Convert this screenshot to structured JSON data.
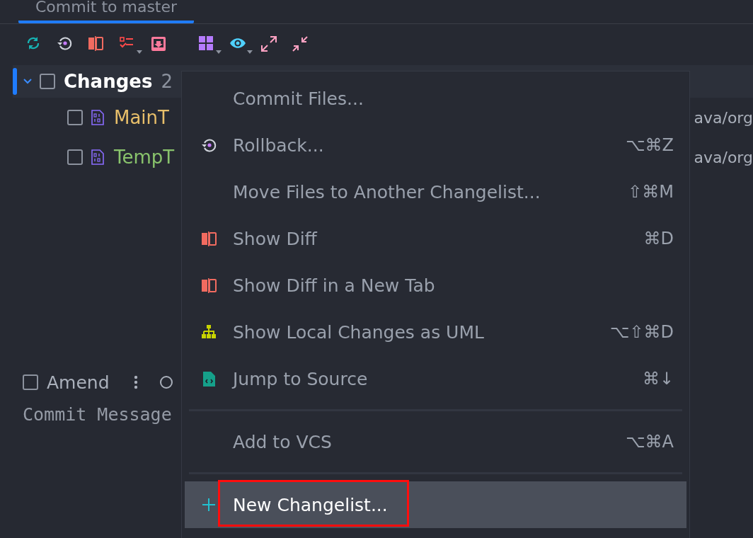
{
  "tab": {
    "label": "Commit to master",
    "selected": true
  },
  "toolbar": {
    "buttons": [
      {
        "kind": "refresh",
        "dropdown": false
      },
      {
        "kind": "rollback",
        "dropdown": false
      },
      {
        "kind": "diff",
        "dropdown": false
      },
      {
        "kind": "checklist",
        "dropdown": true
      },
      {
        "kind": "shelve",
        "dropdown": false
      },
      {
        "kind": "group",
        "dropdown": true
      },
      {
        "kind": "view",
        "dropdown": true
      },
      {
        "kind": "expand",
        "dropdown": false
      },
      {
        "kind": "collapse",
        "dropdown": false
      }
    ]
  },
  "tree": {
    "label": "Changes",
    "count": "2",
    "expanded": true,
    "checked": false,
    "selected": true,
    "children": [
      {
        "name": "MainT",
        "path": "ava/org",
        "color": "#e8bf6a",
        "checked": false
      },
      {
        "name": "TempT",
        "path": "ava/org",
        "color": "#89c36c",
        "checked": false
      }
    ]
  },
  "amend": {
    "label": "Amend",
    "checked": false
  },
  "commit_message": {
    "placeholder": "Commit Message"
  },
  "context_menu": {
    "items": [
      {
        "kind": "action",
        "label": "Commit Files...",
        "selected": false
      },
      {
        "kind": "action",
        "label": "Rollback...",
        "shortcut": "⌥⌘Z",
        "selected": false
      },
      {
        "kind": "action",
        "label": "Move Files to Another Changelist...",
        "shortcut": "⇧⌘M",
        "selected": false
      },
      {
        "kind": "action",
        "label": "Show Diff",
        "shortcut": "⌘D",
        "selected": false
      },
      {
        "kind": "action",
        "label": "Show Diff in a New Tab",
        "selected": false
      },
      {
        "kind": "action",
        "label": "Show Local Changes as UML",
        "shortcut": "⌥⇧⌘D",
        "selected": false
      },
      {
        "kind": "action",
        "label": "Jump to Source",
        "shortcut": "⌘↓",
        "selected": false
      },
      {
        "kind": "separator"
      },
      {
        "kind": "action",
        "label": "Add to VCS",
        "shortcut": "⌥⌘A",
        "selected": false
      },
      {
        "kind": "separator"
      },
      {
        "kind": "action",
        "label": "New Changelist...",
        "selected": true,
        "annotated": true
      }
    ]
  }
}
